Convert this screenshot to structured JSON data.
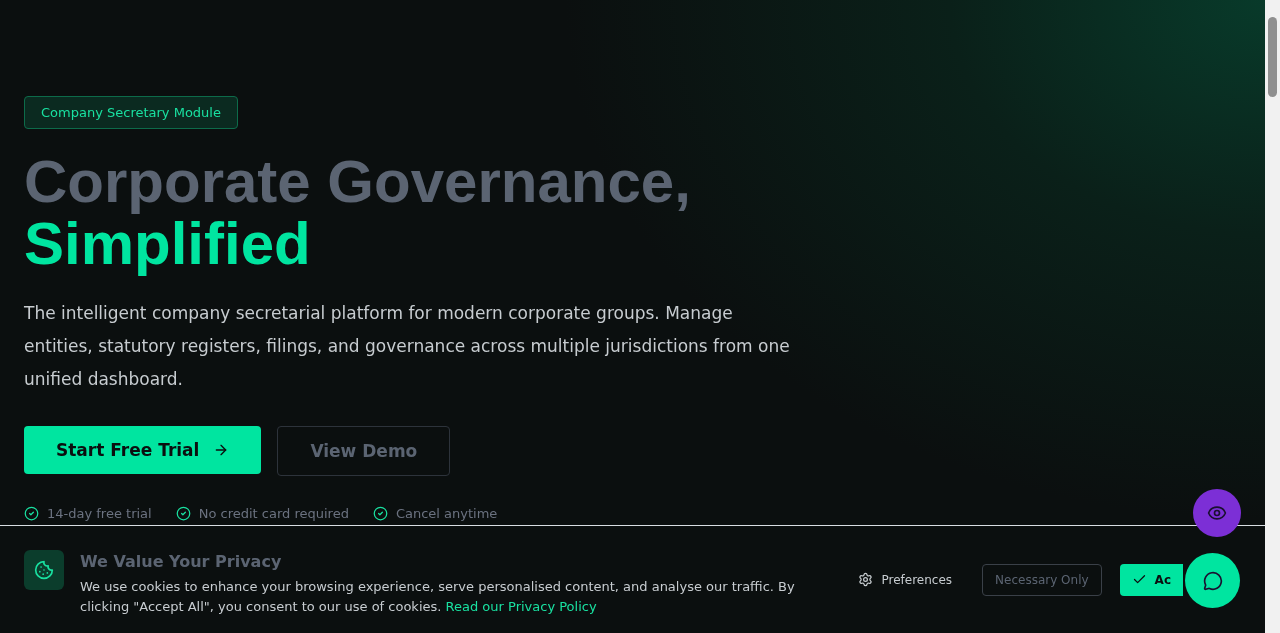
{
  "hero": {
    "badge": "Company Secretary Module",
    "title_lines": [
      {
        "text": "Corporate Governance,",
        "accent": false
      },
      {
        "text": "Simplified",
        "accent": true
      }
    ],
    "description": "The intelligent company secretarial platform for modern corporate groups. Manage entities, statutory registers, filings, and governance across multiple jurisdictions from one unified dashboard.",
    "buttons": [
      {
        "label": "Start Free Trial",
        "kind": "primary"
      },
      {
        "label": "View Demo",
        "kind": "outline"
      }
    ],
    "features": [
      "14-day free trial",
      "No credit card required",
      "Cancel anytime"
    ]
  },
  "cookie_banner": {
    "title": "We Value Your Privacy",
    "text": "We use cookies to enhance your browsing experience, serve personalised content, and analyse our traffic. By clicking \"Accept All\", you consent to our use of cookies.",
    "link": "Read our Privacy Policy",
    "buttons": [
      {
        "label": "Preferences",
        "kind": "ghost"
      },
      {
        "label": "Necessary Only",
        "kind": "outline"
      },
      {
        "label": "Ac",
        "kind": "primary"
      }
    ]
  }
}
